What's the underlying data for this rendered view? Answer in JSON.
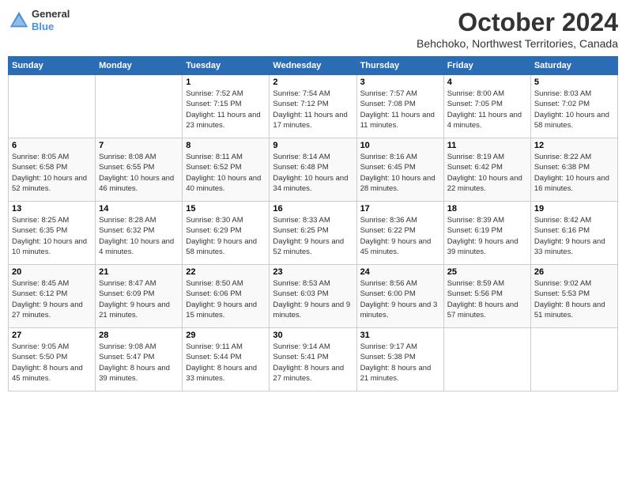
{
  "header": {
    "logo_line1": "General",
    "logo_line2": "Blue",
    "month": "October 2024",
    "location": "Behchoko, Northwest Territories, Canada"
  },
  "weekdays": [
    "Sunday",
    "Monday",
    "Tuesday",
    "Wednesday",
    "Thursday",
    "Friday",
    "Saturday"
  ],
  "weeks": [
    [
      {
        "day": "",
        "info": ""
      },
      {
        "day": "",
        "info": ""
      },
      {
        "day": "1",
        "info": "Sunrise: 7:52 AM\nSunset: 7:15 PM\nDaylight: 11 hours and 23 minutes."
      },
      {
        "day": "2",
        "info": "Sunrise: 7:54 AM\nSunset: 7:12 PM\nDaylight: 11 hours and 17 minutes."
      },
      {
        "day": "3",
        "info": "Sunrise: 7:57 AM\nSunset: 7:08 PM\nDaylight: 11 hours and 11 minutes."
      },
      {
        "day": "4",
        "info": "Sunrise: 8:00 AM\nSunset: 7:05 PM\nDaylight: 11 hours and 4 minutes."
      },
      {
        "day": "5",
        "info": "Sunrise: 8:03 AM\nSunset: 7:02 PM\nDaylight: 10 hours and 58 minutes."
      }
    ],
    [
      {
        "day": "6",
        "info": "Sunrise: 8:05 AM\nSunset: 6:58 PM\nDaylight: 10 hours and 52 minutes."
      },
      {
        "day": "7",
        "info": "Sunrise: 8:08 AM\nSunset: 6:55 PM\nDaylight: 10 hours and 46 minutes."
      },
      {
        "day": "8",
        "info": "Sunrise: 8:11 AM\nSunset: 6:52 PM\nDaylight: 10 hours and 40 minutes."
      },
      {
        "day": "9",
        "info": "Sunrise: 8:14 AM\nSunset: 6:48 PM\nDaylight: 10 hours and 34 minutes."
      },
      {
        "day": "10",
        "info": "Sunrise: 8:16 AM\nSunset: 6:45 PM\nDaylight: 10 hours and 28 minutes."
      },
      {
        "day": "11",
        "info": "Sunrise: 8:19 AM\nSunset: 6:42 PM\nDaylight: 10 hours and 22 minutes."
      },
      {
        "day": "12",
        "info": "Sunrise: 8:22 AM\nSunset: 6:38 PM\nDaylight: 10 hours and 16 minutes."
      }
    ],
    [
      {
        "day": "13",
        "info": "Sunrise: 8:25 AM\nSunset: 6:35 PM\nDaylight: 10 hours and 10 minutes."
      },
      {
        "day": "14",
        "info": "Sunrise: 8:28 AM\nSunset: 6:32 PM\nDaylight: 10 hours and 4 minutes."
      },
      {
        "day": "15",
        "info": "Sunrise: 8:30 AM\nSunset: 6:29 PM\nDaylight: 9 hours and 58 minutes."
      },
      {
        "day": "16",
        "info": "Sunrise: 8:33 AM\nSunset: 6:25 PM\nDaylight: 9 hours and 52 minutes."
      },
      {
        "day": "17",
        "info": "Sunrise: 8:36 AM\nSunset: 6:22 PM\nDaylight: 9 hours and 45 minutes."
      },
      {
        "day": "18",
        "info": "Sunrise: 8:39 AM\nSunset: 6:19 PM\nDaylight: 9 hours and 39 minutes."
      },
      {
        "day": "19",
        "info": "Sunrise: 8:42 AM\nSunset: 6:16 PM\nDaylight: 9 hours and 33 minutes."
      }
    ],
    [
      {
        "day": "20",
        "info": "Sunrise: 8:45 AM\nSunset: 6:12 PM\nDaylight: 9 hours and 27 minutes."
      },
      {
        "day": "21",
        "info": "Sunrise: 8:47 AM\nSunset: 6:09 PM\nDaylight: 9 hours and 21 minutes."
      },
      {
        "day": "22",
        "info": "Sunrise: 8:50 AM\nSunset: 6:06 PM\nDaylight: 9 hours and 15 minutes."
      },
      {
        "day": "23",
        "info": "Sunrise: 8:53 AM\nSunset: 6:03 PM\nDaylight: 9 hours and 9 minutes."
      },
      {
        "day": "24",
        "info": "Sunrise: 8:56 AM\nSunset: 6:00 PM\nDaylight: 9 hours and 3 minutes."
      },
      {
        "day": "25",
        "info": "Sunrise: 8:59 AM\nSunset: 5:56 PM\nDaylight: 8 hours and 57 minutes."
      },
      {
        "day": "26",
        "info": "Sunrise: 9:02 AM\nSunset: 5:53 PM\nDaylight: 8 hours and 51 minutes."
      }
    ],
    [
      {
        "day": "27",
        "info": "Sunrise: 9:05 AM\nSunset: 5:50 PM\nDaylight: 8 hours and 45 minutes."
      },
      {
        "day": "28",
        "info": "Sunrise: 9:08 AM\nSunset: 5:47 PM\nDaylight: 8 hours and 39 minutes."
      },
      {
        "day": "29",
        "info": "Sunrise: 9:11 AM\nSunset: 5:44 PM\nDaylight: 8 hours and 33 minutes."
      },
      {
        "day": "30",
        "info": "Sunrise: 9:14 AM\nSunset: 5:41 PM\nDaylight: 8 hours and 27 minutes."
      },
      {
        "day": "31",
        "info": "Sunrise: 9:17 AM\nSunset: 5:38 PM\nDaylight: 8 hours and 21 minutes."
      },
      {
        "day": "",
        "info": ""
      },
      {
        "day": "",
        "info": ""
      }
    ]
  ]
}
